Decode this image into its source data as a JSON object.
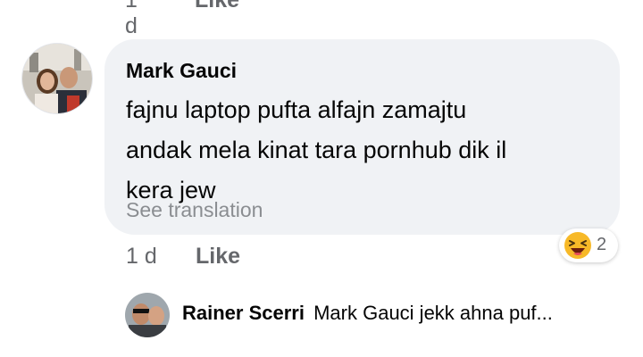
{
  "previous_comment": {
    "time": "1 d",
    "like_label": "Like"
  },
  "comment": {
    "author": "Mark Gauci",
    "text": "fajnu laptop pufta alfajn zamajtu\nandak mela kinat tara pornhub dik il\nkera jew",
    "see_translation_label": "See translation",
    "time": "1 d",
    "like_label": "Like",
    "reaction": {
      "icon": "laughing-emoji-icon",
      "count": "2"
    }
  },
  "reply_preview": {
    "author": "Rainer Scerri",
    "snippet": "Mark Gauci jekk ahna puf..."
  },
  "colors": {
    "bubble": "#f0f2f5",
    "secondary_text": "#65676b",
    "muted_text": "#8a8d91",
    "emoji_face": "#f7b928"
  }
}
